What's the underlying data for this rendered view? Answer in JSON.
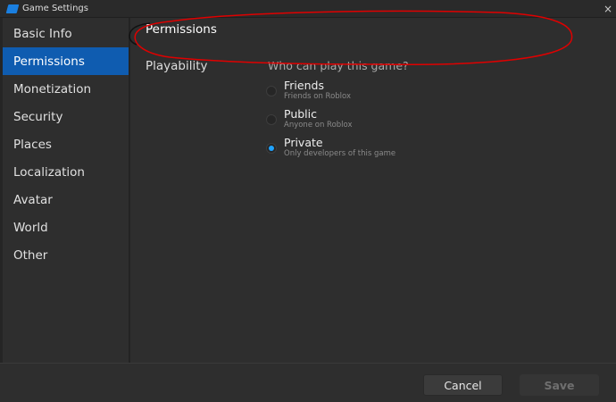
{
  "window": {
    "title": "Game Settings",
    "close_icon": "×"
  },
  "sidebar": {
    "items": [
      {
        "label": "Basic Info"
      },
      {
        "label": "Permissions",
        "selected": true
      },
      {
        "label": "Monetization"
      },
      {
        "label": "Security"
      },
      {
        "label": "Places"
      },
      {
        "label": "Localization"
      },
      {
        "label": "Avatar"
      },
      {
        "label": "World"
      },
      {
        "label": "Other"
      }
    ]
  },
  "main": {
    "header": "Permissions",
    "section_label": "Playability",
    "question": "Who can play this game?",
    "options": [
      {
        "label": "Friends",
        "sub": "Friends on Roblox",
        "selected": false
      },
      {
        "label": "Public",
        "sub": "Anyone on Roblox",
        "selected": false
      },
      {
        "label": "Private",
        "sub": "Only developers of this game",
        "selected": true
      }
    ]
  },
  "footer": {
    "cancel": "Cancel",
    "save": "Save"
  },
  "colors": {
    "accent": "#0f5cb0",
    "radio_selected": "#1fa3ff",
    "annotation": "#e00000"
  }
}
